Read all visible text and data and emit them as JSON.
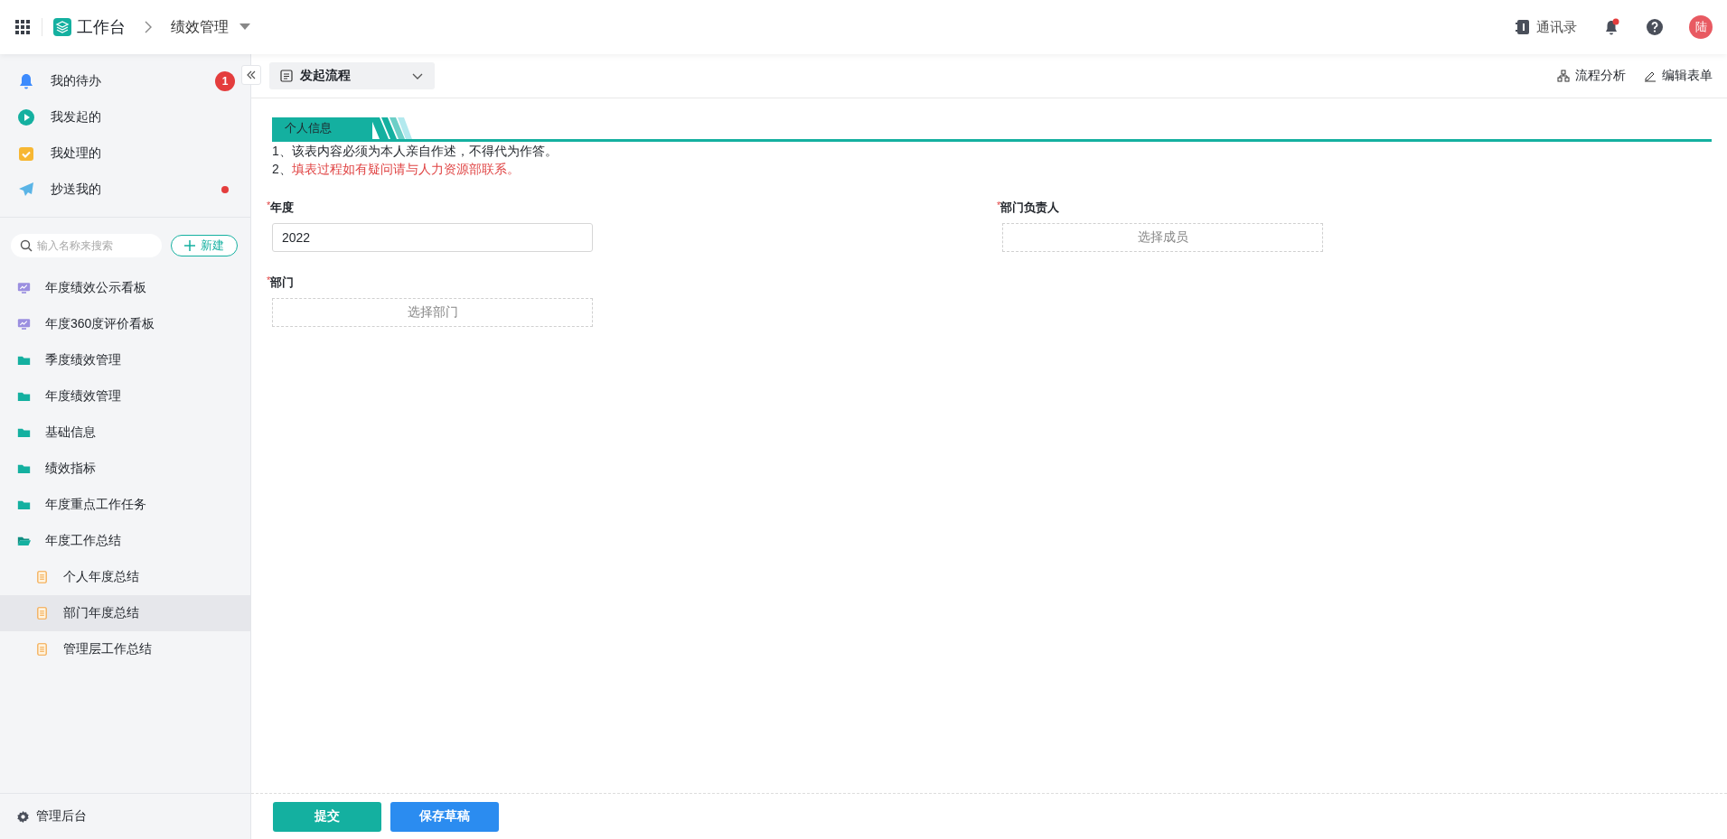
{
  "header": {
    "title": "工作台",
    "app": "绩效管理",
    "contacts": "通讯录",
    "notifications_unread": true,
    "avatar": "陆"
  },
  "sidebar": {
    "quick": [
      {
        "label": "我的待办",
        "kind": "bell",
        "badge": "1",
        "dot": false
      },
      {
        "label": "我发起的",
        "kind": "play",
        "dot": false
      },
      {
        "label": "我处理的",
        "kind": "check",
        "dot": false
      },
      {
        "label": "抄送我的",
        "kind": "send",
        "dot": true
      }
    ],
    "search": {
      "placeholder": "输入名称来搜索"
    },
    "new_button": "新建",
    "items": [
      {
        "label": "年度绩效公示看板",
        "kind": "board"
      },
      {
        "label": "年度360度评价看板",
        "kind": "board"
      },
      {
        "label": "季度绩效管理",
        "kind": "folder",
        "expanded": false
      },
      {
        "label": "年度绩效管理",
        "kind": "folder",
        "expanded": false
      },
      {
        "label": "基础信息",
        "kind": "folder",
        "expanded": false
      },
      {
        "label": "绩效指标",
        "kind": "folder",
        "expanded": false
      },
      {
        "label": "年度重点工作任务",
        "kind": "folder",
        "expanded": false
      },
      {
        "label": "年度工作总结",
        "kind": "folder",
        "expanded": true,
        "children": [
          {
            "label": "个人年度总结",
            "kind": "form",
            "selected": false
          },
          {
            "label": "部门年度总结",
            "kind": "form",
            "selected": true
          },
          {
            "label": "管理层工作总结",
            "kind": "form",
            "selected": false
          }
        ]
      }
    ],
    "footer": "管理后台"
  },
  "toolbar": {
    "process": "发起流程",
    "actions": [
      {
        "label": "流程分析",
        "kind": "flow"
      },
      {
        "label": "编辑表单",
        "kind": "edit"
      }
    ]
  },
  "section": {
    "title": "个人信息"
  },
  "notes": [
    {
      "number": "1、",
      "text": "该表内容必须为本人亲自作述，不得代为作答。",
      "kind": "normal"
    },
    {
      "number": "2、",
      "text": "填表过程如有疑问请与人力资源部联系。",
      "kind": "warning"
    }
  ],
  "fields": [
    {
      "label": "年度",
      "required_mark": "*",
      "kind": "input",
      "value": "2022"
    },
    {
      "label": "部门负责人",
      "required_mark": "*",
      "kind": "picker",
      "placeholder": "选择成员"
    },
    {
      "label": "部门",
      "required_mark": "*",
      "kind": "picker",
      "placeholder": "选择部门"
    }
  ],
  "buttons": [
    {
      "label": "提交",
      "kind": "primary"
    },
    {
      "label": "保存草稿",
      "kind": "secondary"
    }
  ]
}
